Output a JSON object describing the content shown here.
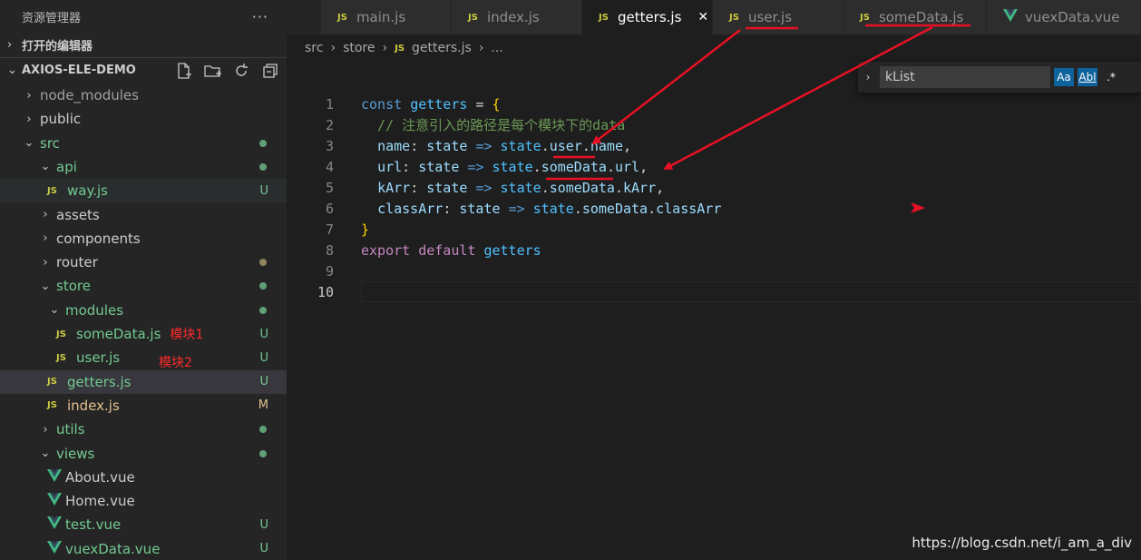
{
  "sidebar": {
    "title": "资源管理器",
    "more": "···",
    "open_editors": "打开的编辑器",
    "project": "AXIOS-ELE-DEMO",
    "tree": [
      {
        "label": "node_modules",
        "kind": "folder",
        "open": false,
        "level": 1,
        "muted": true
      },
      {
        "label": "public",
        "kind": "folder",
        "open": false,
        "level": 1
      },
      {
        "label": "src",
        "kind": "folder",
        "open": true,
        "level": 1,
        "green": true,
        "dot": true
      },
      {
        "label": "api",
        "kind": "folder",
        "open": true,
        "level": 2,
        "green": true,
        "dot": true
      },
      {
        "label": "way.js",
        "kind": "js",
        "level": 3,
        "green": true,
        "status": "U"
      },
      {
        "label": "assets",
        "kind": "folder",
        "open": false,
        "level": 2
      },
      {
        "label": "components",
        "kind": "folder",
        "open": false,
        "level": 2
      },
      {
        "label": "router",
        "kind": "folder",
        "open": false,
        "level": 2,
        "dot": true,
        "dot_color": "#b3a46f"
      },
      {
        "label": "store",
        "kind": "folder",
        "open": true,
        "level": 2,
        "green": true,
        "dot": true
      },
      {
        "label": "modules",
        "kind": "folder",
        "open": true,
        "level": 3,
        "green": true,
        "dot": true
      },
      {
        "label": "someData.js",
        "kind": "js",
        "level": 4,
        "green": true,
        "status": "U",
        "note": "模块1"
      },
      {
        "label": "user.js",
        "kind": "js",
        "level": 4,
        "green": true,
        "status": "U",
        "note": "模块2"
      },
      {
        "label": "getters.js",
        "kind": "js",
        "level": 3,
        "green": true,
        "status": "U"
      },
      {
        "label": "index.js",
        "kind": "js",
        "level": 3,
        "mod": true,
        "status": "M"
      },
      {
        "label": "utils",
        "kind": "folder",
        "open": false,
        "level": 2,
        "green": true,
        "dot": true
      },
      {
        "label": "views",
        "kind": "folder",
        "open": true,
        "level": 2,
        "green": true,
        "dot": true
      },
      {
        "label": "About.vue",
        "kind": "vue",
        "level": 3
      },
      {
        "label": "Home.vue",
        "kind": "vue",
        "level": 3
      },
      {
        "label": "test.vue",
        "kind": "vue",
        "level": 3,
        "green": true,
        "status": "U"
      },
      {
        "label": "vuexData.vue",
        "kind": "vue",
        "level": 3,
        "green": true,
        "status": "U"
      }
    ]
  },
  "tabs": [
    {
      "label": "main.js",
      "kind": "js"
    },
    {
      "label": "index.js",
      "kind": "js"
    },
    {
      "label": "getters.js",
      "kind": "js",
      "active": true,
      "close": "✕"
    },
    {
      "label": "user.js",
      "kind": "js",
      "underline": true
    },
    {
      "label": "someData.js",
      "kind": "js",
      "underline": true
    },
    {
      "label": "vuexData.vue",
      "kind": "vue"
    }
  ],
  "breadcrumb": [
    "src",
    "store",
    "getters.js",
    "..."
  ],
  "find": {
    "value": "kList",
    "case_label": "Aa",
    "word_label": "Abl",
    "regex_label": ".*"
  },
  "editor": {
    "lines": [
      "1",
      "2",
      "3",
      "4",
      "5",
      "6",
      "7",
      "8",
      "9",
      "10"
    ],
    "current_line": "10"
  },
  "colors": {
    "accent": "#0e639c",
    "untracked": "#73c991",
    "modified": "#e2c08d",
    "annotation": "#e81123"
  },
  "watermark": "https://blog.csdn.net/i_am_a_div"
}
